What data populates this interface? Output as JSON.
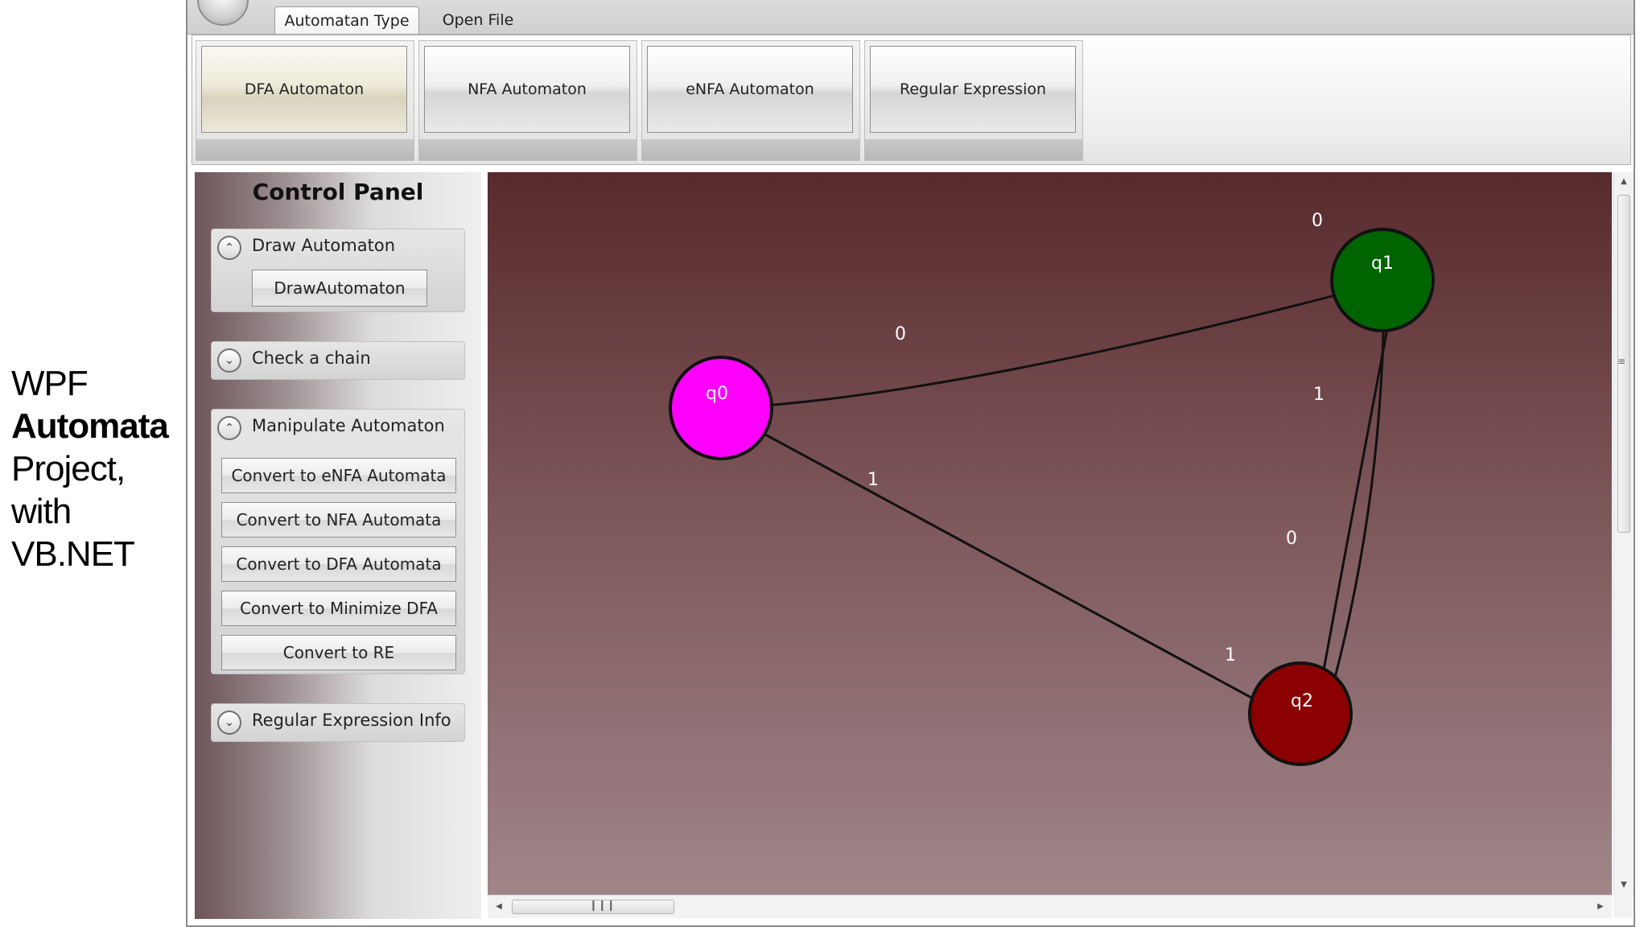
{
  "side_caption": {
    "line1": "WPF",
    "line2": "Automata",
    "line3": "Project,",
    "line4": "with VB.NET"
  },
  "tabs": [
    {
      "label": "Automatan Type",
      "active": true
    },
    {
      "label": "Open File",
      "active": false
    }
  ],
  "ribbon": {
    "buttons": [
      {
        "label": "DFA Automaton",
        "selected": true
      },
      {
        "label": "NFA Automaton",
        "selected": false
      },
      {
        "label": "eNFA Automaton",
        "selected": false
      },
      {
        "label": "Regular Expression",
        "selected": false
      }
    ]
  },
  "control_panel": {
    "title": "Control Panel",
    "draw": {
      "header": "Draw Automaton",
      "button": "DrawAutomaton"
    },
    "check": {
      "header": "Check a chain"
    },
    "manipulate": {
      "header": "Manipulate Automaton",
      "buttons": [
        "Convert to eNFA Automata",
        "Convert to NFA Automata",
        "Convert to DFA Automata",
        "Convert to Minimize DFA",
        "Convert to RE"
      ]
    },
    "regex_info": {
      "header": "Regular Expression Info"
    }
  },
  "automaton": {
    "states": [
      {
        "id": "q0",
        "label": "q0",
        "color": "#ff00ff"
      },
      {
        "id": "q1",
        "label": "q1",
        "color": "#006400"
      },
      {
        "id": "q2",
        "label": "q2",
        "color": "#8b0000"
      }
    ],
    "transitions": [
      {
        "from": "q0",
        "to": "q1",
        "symbol": "0"
      },
      {
        "from": "q0",
        "to": "q2",
        "symbol": "1"
      },
      {
        "from": "q1",
        "to": "q1",
        "symbol": "0"
      },
      {
        "from": "q1",
        "to": "q2",
        "symbol": "1"
      },
      {
        "from": "q2",
        "to": "q1",
        "symbol": "0"
      },
      {
        "from": "q2",
        "to": "q2",
        "symbol": "1"
      }
    ]
  },
  "colors": {
    "canvas_top": "#582a2d",
    "canvas_bottom": "#a08589"
  }
}
